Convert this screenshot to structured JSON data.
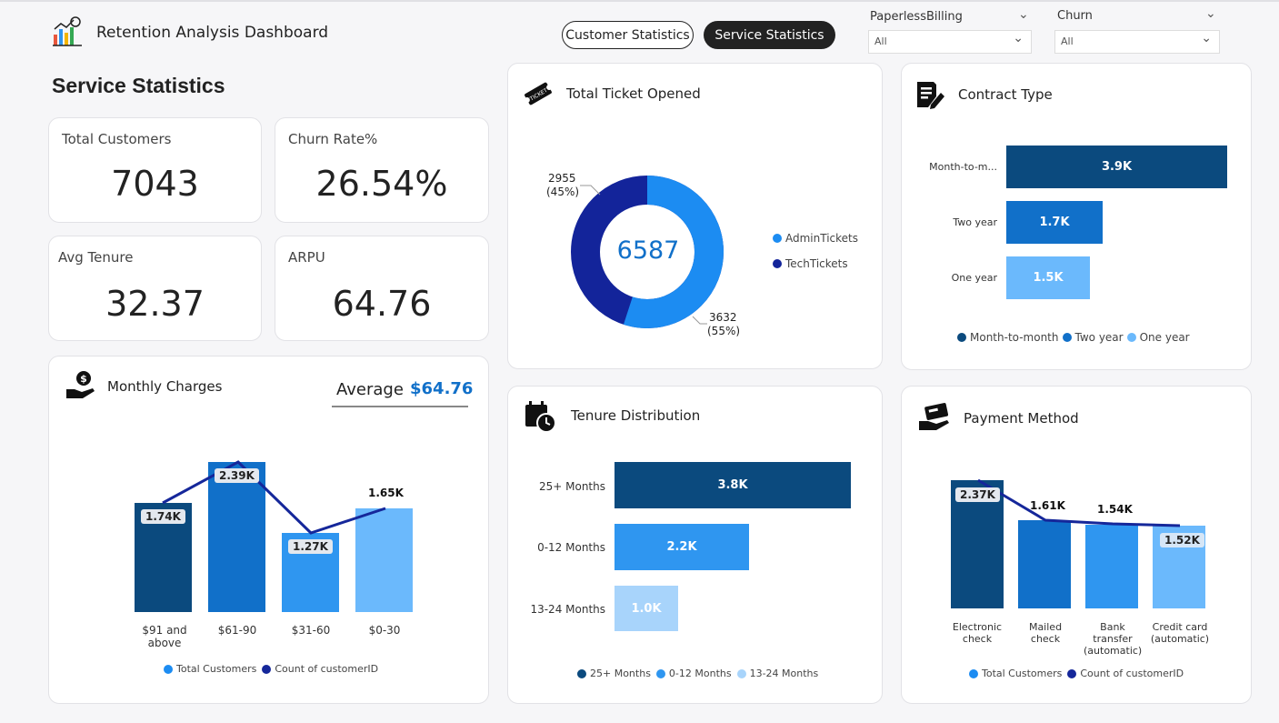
{
  "app": {
    "title": "Retention Analysis Dashboard"
  },
  "nav": {
    "tab_customer": "Customer Statistics",
    "tab_service": "Service Statistics"
  },
  "filters": {
    "paperless": {
      "label": "PaperlessBilling",
      "value": "All"
    },
    "churn": {
      "label": "Churn",
      "value": "All"
    }
  },
  "page": {
    "title": "Service Statistics"
  },
  "kpis": [
    {
      "label": "Total Customers",
      "value": "7043"
    },
    {
      "label": "Churn Rate%",
      "value": "26.54%"
    },
    {
      "label": "Avg Tenure",
      "value": "32.37"
    },
    {
      "label": "ARPU",
      "value": "64.76"
    }
  ],
  "monthly": {
    "title": "Monthly Charges",
    "avg_label": "Average",
    "avg_value": "$64.76"
  },
  "tickets": {
    "title": "Total Ticket Opened",
    "center": "6587",
    "top_label": "2955",
    "top_pct": "(45%)",
    "bottom_label": "3632",
    "bottom_pct": "(55%)"
  },
  "contract": {
    "title": "Contract Type"
  },
  "tenure": {
    "title": "Tenure Distribution"
  },
  "payment": {
    "title": "Payment Method"
  },
  "colors": {
    "dark": "#0B4A7E",
    "mid": "#1170C9",
    "blue": "#2F96F0",
    "light": "#6BB9FC",
    "pale": "#A8D4FB",
    "navy": "#15279A",
    "donut_light": "#1C8CF2",
    "donut_dark": "#13249A"
  },
  "chart_data": [
    {
      "type": "bar",
      "name": "Monthly Charges",
      "categories": [
        "$91 and above",
        "$61-90",
        "$31-60",
        "$0-30"
      ],
      "series": [
        {
          "name": "Total Customers",
          "values": [
            1740,
            2390,
            1270,
            1650
          ]
        },
        {
          "name": "Count of customerID",
          "values": [
            1740,
            2390,
            1270,
            1650
          ]
        }
      ],
      "data_labels": [
        "1.74K",
        "2.39K",
        "1.27K",
        "1.65K"
      ],
      "legend": [
        "Total Customers",
        "Count of customerID"
      ]
    },
    {
      "type": "pie",
      "name": "Total Ticket Opened",
      "categories": [
        "AdminTickets",
        "TechTickets"
      ],
      "values": [
        3632,
        2955
      ],
      "total": 6587,
      "legend": [
        "AdminTickets",
        "TechTickets"
      ]
    },
    {
      "type": "bar",
      "name": "Contract Type",
      "categories": [
        "Month-to-m...",
        "Two year",
        "One year"
      ],
      "values": [
        3900,
        1700,
        1500
      ],
      "data_labels": [
        "3.9K",
        "1.7K",
        "1.5K"
      ],
      "legend": [
        "Month-to-month",
        "Two year",
        "One year"
      ]
    },
    {
      "type": "bar",
      "name": "Tenure Distribution",
      "categories": [
        "25+ Months",
        "0-12 Months",
        "13-24 Months"
      ],
      "values": [
        3800,
        2200,
        1000
      ],
      "data_labels": [
        "3.8K",
        "2.2K",
        "1.0K"
      ],
      "legend": [
        "25+ Months",
        "0-12 Months",
        "13-24 Months"
      ]
    },
    {
      "type": "bar",
      "name": "Payment Method",
      "categories": [
        "Electronic check",
        "Mailed check",
        "Bank transfer (automatic)",
        "Credit card (automatic)"
      ],
      "series": [
        {
          "name": "Total Customers",
          "values": [
            2370,
            1610,
            1540,
            1520
          ]
        },
        {
          "name": "Count of customerID",
          "values": [
            2370,
            1610,
            1540,
            1520
          ]
        }
      ],
      "data_labels": [
        "2.37K",
        "1.61K",
        "1.54K",
        "1.52K"
      ],
      "legend": [
        "Total Customers",
        "Count of customerID"
      ]
    }
  ]
}
